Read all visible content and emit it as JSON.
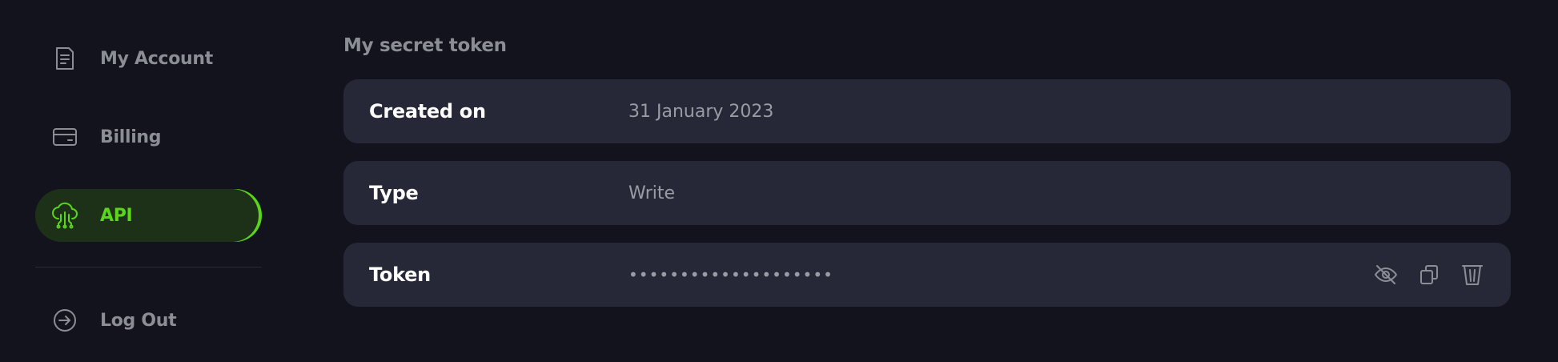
{
  "sidebar": {
    "items": [
      {
        "label": "My Account",
        "icon": "document-icon"
      },
      {
        "label": "Billing",
        "icon": "card-icon"
      },
      {
        "label": "API",
        "icon": "cloud-network-icon",
        "active": true
      },
      {
        "label": "Log Out",
        "icon": "logout-icon"
      }
    ]
  },
  "main": {
    "title": "My secret token",
    "rows": [
      {
        "key": "Created on",
        "value": "31 January 2023"
      },
      {
        "key": "Type",
        "value": "Write"
      },
      {
        "key": "Token",
        "value": "••••••••••••••••••••"
      }
    ]
  },
  "colors": {
    "background": "#12131c",
    "card": "#262837",
    "accent": "#5ad51b",
    "muted": "#8c8e96"
  }
}
